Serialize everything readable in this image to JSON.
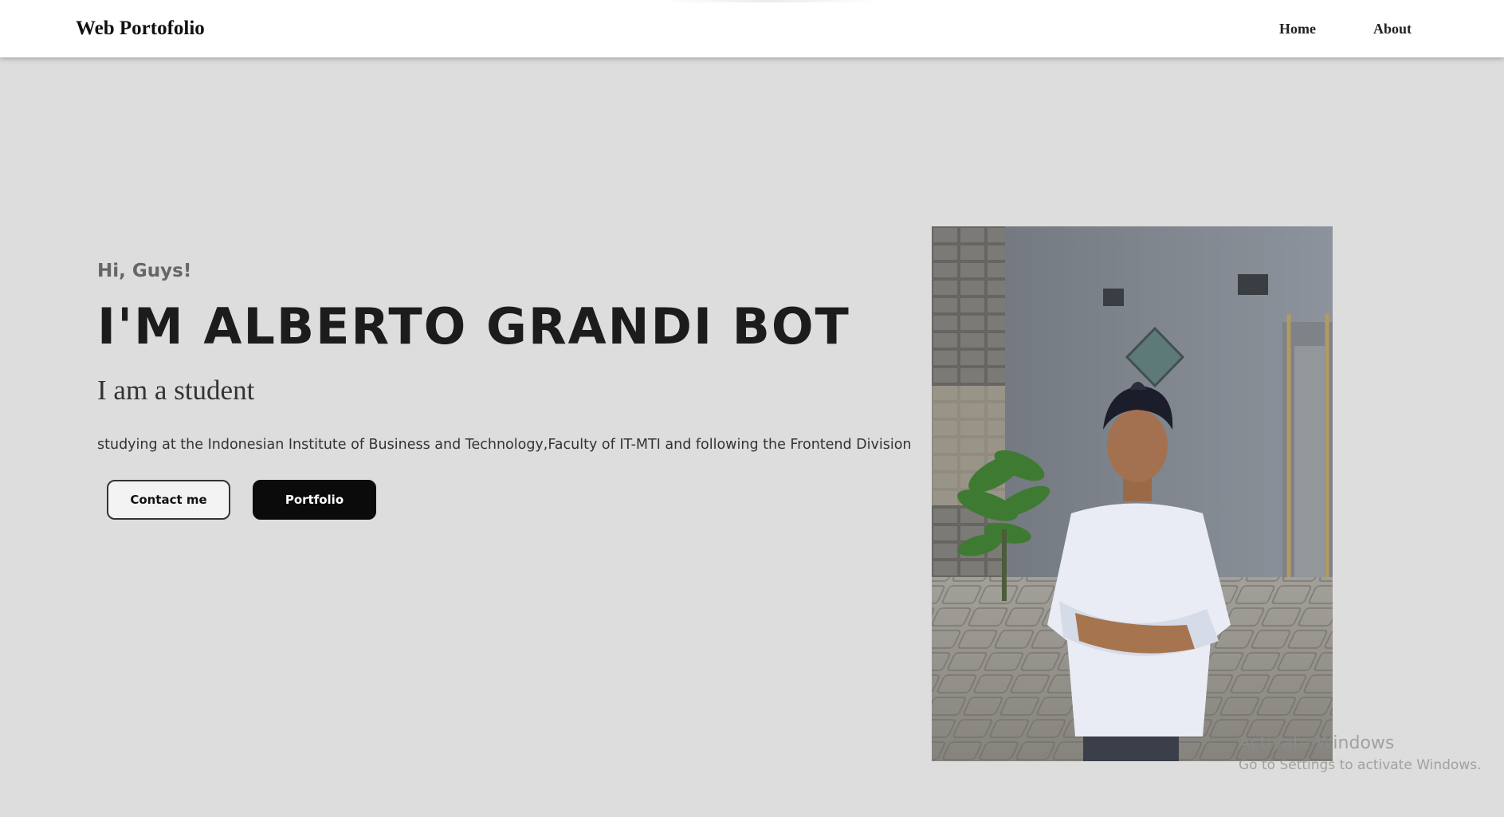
{
  "header": {
    "brand": "Web Portofolio",
    "nav": [
      {
        "label": "Home"
      },
      {
        "label": "About"
      }
    ]
  },
  "hero": {
    "greeting": "Hi, Guys!",
    "name": "I'M ALBERTO GRANDI BOT",
    "role": "I am a student",
    "description": "studying at the Indonesian Institute of Business and Technology,Faculty of IT-MTI and following the Frontend Division",
    "buttons": {
      "contact": "Contact me",
      "portfolio": "Portfolio"
    }
  },
  "watermark": {
    "title": "Activate Windows",
    "subtitle": "Go to Settings to activate Windows."
  }
}
